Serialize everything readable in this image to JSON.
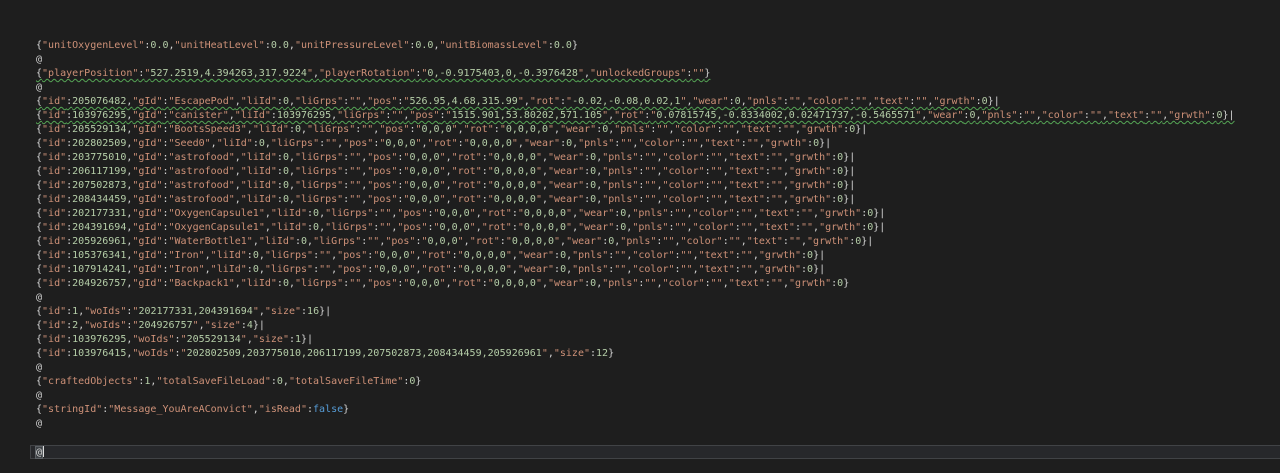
{
  "editor": {
    "background": "#1e1e1e",
    "colors": {
      "punctuation": "#d4d4d4",
      "string": "#ce9178",
      "number": "#b5cea8",
      "keyword": "#569cd6",
      "squiggle": "#55a555",
      "current_line_bg": "#27282b",
      "current_line_border": "#414346",
      "caret": "#dcdcdc"
    },
    "lines": [
      {
        "text": "{\"unitOxygenLevel\":0.0,\"unitHeatLevel\":0.0,\"unitPressureLevel\":0.0,\"unitBiomassLevel\":0.0}",
        "squiggle": false,
        "current": false
      },
      {
        "text": "@",
        "squiggle": false,
        "current": false
      },
      {
        "text": "{\"playerPosition\":\"527.2519,4.394263,317.9224\",\"playerRotation\":\"0,-0.9175403,0,-0.3976428\",\"unlockedGroups\":\"\"}",
        "squiggle": true,
        "current": false
      },
      {
        "text": "@",
        "squiggle": false,
        "current": false
      },
      {
        "text": "{\"id\":205076482,\"gId\":\"EscapePod\",\"liId\":0,\"liGrps\":\"\",\"pos\":\"526.95,4.68,315.99\",\"rot\":\"-0.02,-0.08,0.02,1\",\"wear\":0,\"pnls\":\"\",\"color\":\"\",\"text\":\"\",\"grwth\":0}|",
        "squiggle": true,
        "current": false
      },
      {
        "text": "{\"id\":103976295,\"gId\":\"canister\",\"liId\":103976295,\"liGrps\":\"\",\"pos\":\"1515.901,53.80202,571.105\",\"rot\":\"0.07815745,-0.8334002,0.02471737,-0.5465571\",\"wear\":0,\"pnls\":\"\",\"color\":\"\",\"text\":\"\",\"grwth\":0}|",
        "squiggle": true,
        "current": false
      },
      {
        "text": "{\"id\":205529134,\"gId\":\"BootsSpeed3\",\"liId\":0,\"liGrps\":\"\",\"pos\":\"0,0,0\",\"rot\":\"0,0,0,0\",\"wear\":0,\"pnls\":\"\",\"color\":\"\",\"text\":\"\",\"grwth\":0}|",
        "squiggle": false,
        "current": false
      },
      {
        "text": "{\"id\":202802509,\"gId\":\"Seed0\",\"liId\":0,\"liGrps\":\"\",\"pos\":\"0,0,0\",\"rot\":\"0,0,0,0\",\"wear\":0,\"pnls\":\"\",\"color\":\"\",\"text\":\"\",\"grwth\":0}|",
        "squiggle": false,
        "current": false
      },
      {
        "text": "{\"id\":203775010,\"gId\":\"astrofood\",\"liId\":0,\"liGrps\":\"\",\"pos\":\"0,0,0\",\"rot\":\"0,0,0,0\",\"wear\":0,\"pnls\":\"\",\"color\":\"\",\"text\":\"\",\"grwth\":0}|",
        "squiggle": false,
        "current": false
      },
      {
        "text": "{\"id\":206117199,\"gId\":\"astrofood\",\"liId\":0,\"liGrps\":\"\",\"pos\":\"0,0,0\",\"rot\":\"0,0,0,0\",\"wear\":0,\"pnls\":\"\",\"color\":\"\",\"text\":\"\",\"grwth\":0}|",
        "squiggle": false,
        "current": false
      },
      {
        "text": "{\"id\":207502873,\"gId\":\"astrofood\",\"liId\":0,\"liGrps\":\"\",\"pos\":\"0,0,0\",\"rot\":\"0,0,0,0\",\"wear\":0,\"pnls\":\"\",\"color\":\"\",\"text\":\"\",\"grwth\":0}|",
        "squiggle": false,
        "current": false
      },
      {
        "text": "{\"id\":208434459,\"gId\":\"astrofood\",\"liId\":0,\"liGrps\":\"\",\"pos\":\"0,0,0\",\"rot\":\"0,0,0,0\",\"wear\":0,\"pnls\":\"\",\"color\":\"\",\"text\":\"\",\"grwth\":0}|",
        "squiggle": false,
        "current": false
      },
      {
        "text": "{\"id\":202177331,\"gId\":\"OxygenCapsule1\",\"liId\":0,\"liGrps\":\"\",\"pos\":\"0,0,0\",\"rot\":\"0,0,0,0\",\"wear\":0,\"pnls\":\"\",\"color\":\"\",\"text\":\"\",\"grwth\":0}|",
        "squiggle": false,
        "current": false
      },
      {
        "text": "{\"id\":204391694,\"gId\":\"OxygenCapsule1\",\"liId\":0,\"liGrps\":\"\",\"pos\":\"0,0,0\",\"rot\":\"0,0,0,0\",\"wear\":0,\"pnls\":\"\",\"color\":\"\",\"text\":\"\",\"grwth\":0}|",
        "squiggle": false,
        "current": false
      },
      {
        "text": "{\"id\":205926961,\"gId\":\"WaterBottle1\",\"liId\":0,\"liGrps\":\"\",\"pos\":\"0,0,0\",\"rot\":\"0,0,0,0\",\"wear\":0,\"pnls\":\"\",\"color\":\"\",\"text\":\"\",\"grwth\":0}|",
        "squiggle": false,
        "current": false
      },
      {
        "text": "{\"id\":105376341,\"gId\":\"Iron\",\"liId\":0,\"liGrps\":\"\",\"pos\":\"0,0,0\",\"rot\":\"0,0,0,0\",\"wear\":0,\"pnls\":\"\",\"color\":\"\",\"text\":\"\",\"grwth\":0}|",
        "squiggle": false,
        "current": false
      },
      {
        "text": "{\"id\":107914241,\"gId\":\"Iron\",\"liId\":0,\"liGrps\":\"\",\"pos\":\"0,0,0\",\"rot\":\"0,0,0,0\",\"wear\":0,\"pnls\":\"\",\"color\":\"\",\"text\":\"\",\"grwth\":0}|",
        "squiggle": false,
        "current": false
      },
      {
        "text": "{\"id\":204926757,\"gId\":\"Backpack1\",\"liId\":0,\"liGrps\":\"\",\"pos\":\"0,0,0\",\"rot\":\"0,0,0,0\",\"wear\":0,\"pnls\":\"\",\"color\":\"\",\"text\":\"\",\"grwth\":0}",
        "squiggle": false,
        "current": false
      },
      {
        "text": "@",
        "squiggle": false,
        "current": false
      },
      {
        "text": "{\"id\":1,\"woIds\":\"202177331,204391694\",\"size\":16}|",
        "squiggle": false,
        "current": false
      },
      {
        "text": "{\"id\":2,\"woIds\":\"204926757\",\"size\":4}|",
        "squiggle": false,
        "current": false
      },
      {
        "text": "{\"id\":103976295,\"woIds\":\"205529134\",\"size\":1}|",
        "squiggle": false,
        "current": false
      },
      {
        "text": "{\"id\":103976415,\"woIds\":\"202802509,203775010,206117199,207502873,208434459,205926961\",\"size\":12}",
        "squiggle": false,
        "current": false
      },
      {
        "text": "@",
        "squiggle": false,
        "current": false
      },
      {
        "text": "{\"craftedObjects\":1,\"totalSaveFileLoad\":0,\"totalSaveFileTime\":0}",
        "squiggle": false,
        "current": false
      },
      {
        "text": "@",
        "squiggle": false,
        "current": false
      },
      {
        "text": "{\"stringId\":\"Message_YouAreAConvict\",\"isRead\":false}",
        "squiggle": false,
        "current": false
      },
      {
        "text": "@",
        "squiggle": false,
        "current": false
      },
      {
        "text": "",
        "squiggle": false,
        "current": false
      },
      {
        "text": "@",
        "squiggle": false,
        "current": true
      }
    ]
  }
}
